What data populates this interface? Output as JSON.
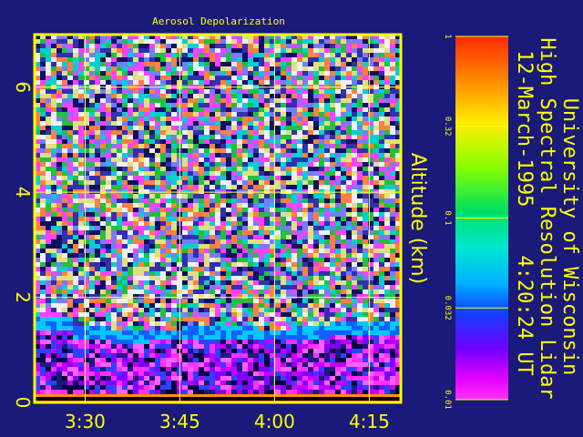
{
  "chart_data": {
    "type": "heatmap",
    "title": "Aerosol Depolarization",
    "ylabel": "Altitude (km)",
    "xlabel": "",
    "x_ticks": [
      "3:30",
      "3:45",
      "4:00",
      "4:15"
    ],
    "x_tick_minutes": [
      30,
      45,
      60,
      75
    ],
    "xlim_minutes": [
      22,
      80
    ],
    "y_ticks": [
      "0",
      "2",
      "4",
      "6"
    ],
    "y_tick_values": [
      0,
      2,
      4,
      6
    ],
    "ylim": [
      0,
      7
    ],
    "grid": true,
    "colorbar": {
      "scale": "log",
      "tick_labels": [
        "1",
        "0.32",
        "0.1",
        "0.032",
        "0.01"
      ],
      "tick_values": [
        1,
        0.32,
        0.1,
        0.032,
        0.01
      ]
    },
    "boundary_layer_top_km": [
      1.7,
      1.5,
      1.4,
      1.45,
      1.5,
      1.5,
      1.45,
      1.5,
      1.55,
      1.6,
      1.55
    ]
  },
  "header": {
    "institution": "University of Wisconsin",
    "instrument": "High Spectral Resolution Lidar",
    "timestamp": "12-March-1995    4:20:24 UT"
  },
  "colors": {
    "background": "#1a1a7a",
    "axis": "#ffff00",
    "grid": "#ffff66"
  }
}
